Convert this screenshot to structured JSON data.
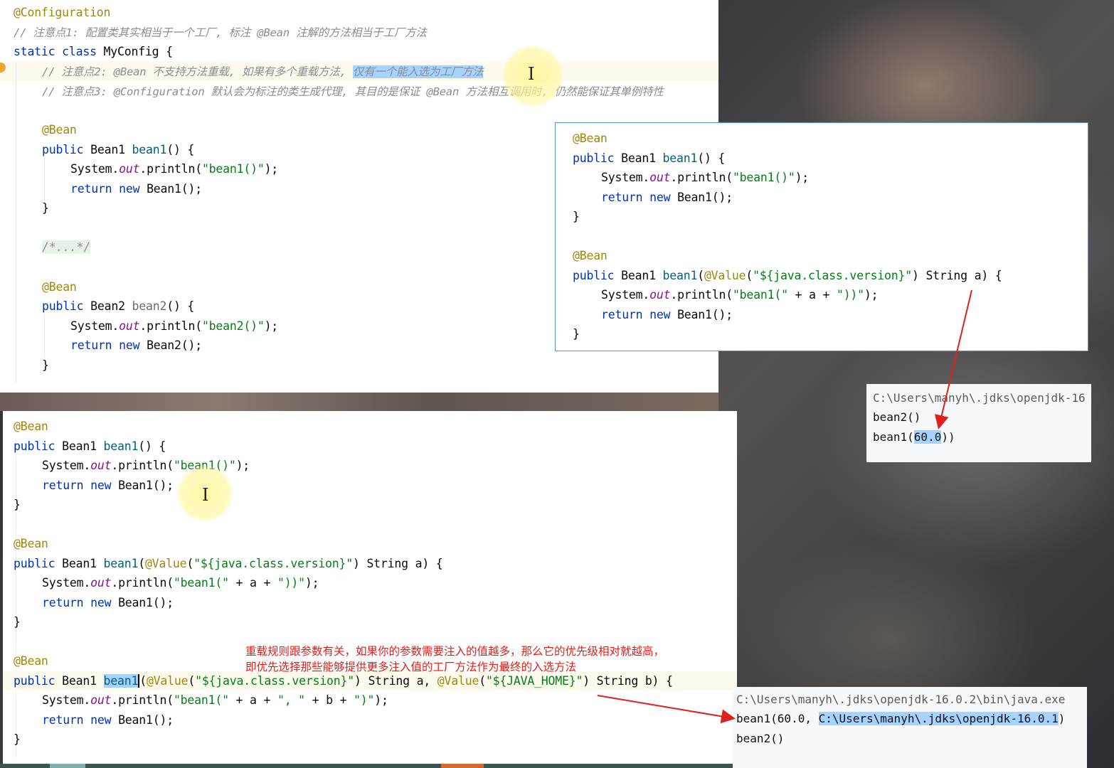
{
  "colors": {
    "keyword": "#0033b3",
    "annotation": "#9e880d",
    "string": "#067d17",
    "static_field": "#871094",
    "method": "#00627a",
    "comment": "#8c8c8c",
    "selection": "#a6d2ff",
    "arrow": "#e0201b"
  },
  "top_editor": {
    "lines": {
      "l1": {
        "ann": "@Configuration"
      },
      "l2": {
        "cmt": "// 注意点1: 配置类其实相当于一个工厂, 标注 @Bean 注解的方法相当于工厂方法"
      },
      "l3": {
        "kw1": "static",
        "kw2": "class",
        "rest": " MyConfig {"
      },
      "l4": {
        "cmt_a": "// 注意点2: @Bean 不支持方法重载, 如果有多个重载方法, ",
        "cmt_sel": "仅有一个能入选为工厂方法"
      },
      "l5": {
        "cmt": "// 注意点3: @Configuration 默认会为标注的类生成代理, 其目的是保证 @Bean 方法相互调用时, 仍然能保证其单例特性"
      },
      "l6": {
        "ann": "@Bean"
      },
      "l7": {
        "kw": "public",
        "type": " Bean1 ",
        "fn": "bean1",
        "rest": "() {"
      },
      "l8": {
        "a": "System.",
        "field": "out",
        "b": ".println(",
        "str": "\"bean1()\"",
        "c": ");"
      },
      "l9": {
        "kw1": "return",
        "kw2": "new",
        "rest": " Bean1();"
      },
      "l10": {
        "brace": "}"
      },
      "l11": {
        "folded": "/*...*/"
      },
      "l12": {
        "ann": "@Bean"
      },
      "l13": {
        "kw": "public",
        "type": " Bean2 ",
        "fn": "bean2",
        "rest": "() {"
      },
      "l14": {
        "a": "System.",
        "field": "out",
        "b": ".println(",
        "str": "\"bean2()\"",
        "c": ");"
      },
      "l15": {
        "kw1": "return",
        "kw2": "new",
        "rest": " Bean2();"
      },
      "l16": {
        "brace": "}"
      }
    }
  },
  "right_editor": {
    "ann1": "@Bean",
    "m1_kw": "public",
    "m1_type": " Bean1 ",
    "m1_fn": "bean1",
    "m1_rest": "() {",
    "m1_a": "System.",
    "m1_field": "out",
    "m1_b": ".println(",
    "m1_str": "\"bean1()\"",
    "m1_c": ");",
    "m1_ret": "return",
    "m1_new": "new",
    "m1_retrest": " Bean1();",
    "brace": "}",
    "ann2": "@Bean",
    "m2_kw": "public",
    "m2_type": " Bean1 ",
    "m2_fn": "bean1",
    "m2_p1": "(",
    "m2_ann": "@Value",
    "m2_p2": "(",
    "m2_str": "\"${java.class.version}\"",
    "m2_rest": ") String a) {",
    "m2_a": "System.",
    "m2_field": "out",
    "m2_b": ".println(",
    "m2_s1": "\"bean1(\"",
    "m2_mid": " + a + ",
    "m2_s2": "\"))\"",
    "m2_c": ");",
    "m2_ret": "return",
    "m2_new": "new",
    "m2_retrest": " Bean1();"
  },
  "console1": {
    "path": "C:\\Users\\manyh\\.jdks\\openjdk-16",
    "line2": "bean2()",
    "line3_a": "bean1(",
    "line3_sel": "60.0",
    "line3_b": "))"
  },
  "bottom_editor": {
    "ann1": "@Bean",
    "m1_kw": "public",
    "m1_type": " Bean1 ",
    "m1_fn": "bean1",
    "m1_rest": "() {",
    "m1_a": "System.",
    "m1_field": "out",
    "m1_b": ".println(",
    "m1_str": "\"bean1()\"",
    "m1_c": ");",
    "m1_ret": "return",
    "m1_new": "new",
    "m1_retrest": " Bean1();",
    "brace": "}",
    "ann2": "@Bean",
    "m2_kw": "public",
    "m2_type": " Bean1 ",
    "m2_fn": "bean1",
    "m2_p1": "(",
    "m2_ann": "@Value",
    "m2_p2": "(",
    "m2_str": "\"${java.class.version}\"",
    "m2_rest": ") String a) {",
    "m2_a": "System.",
    "m2_field": "out",
    "m2_b": ".println(",
    "m2_s1": "\"bean1(\"",
    "m2_mid": " + a + ",
    "m2_s2": "\"))\"",
    "m2_c": ");",
    "m2_ret": "return",
    "m2_new": "new",
    "m2_retrest": " Bean1();",
    "ann3": "@Bean",
    "m3_kw": "public",
    "m3_type": " Bean1 ",
    "m3_fn": "bean1",
    "m3_p1": "(",
    "m3_ann1": "@Value",
    "m3_p2": "(",
    "m3_str1": "\"${java.class.version}\"",
    "m3_mid1": ") String a, ",
    "m3_ann2": "@Value",
    "m3_p3": "(",
    "m3_str2": "\"${JAVA_HOME}\"",
    "m3_rest": ") String b) {",
    "m3_a": "System.",
    "m3_field": "out",
    "m3_b": ".println(",
    "m3_s1": "\"bean1(\"",
    "m3_mid": " + a + ",
    "m3_s2": "\", \"",
    "m3_mid2": " + b + ",
    "m3_s3": "\")\"",
    "m3_c": ");",
    "m3_ret": "return",
    "m3_new": "new",
    "m3_retrest": " Bean1();"
  },
  "note": {
    "line1": "重载规则跟参数有关，如果你的参数需要注入的值越多，那么它的优先级相对就越高，",
    "line2": "即优先选择那些能够提供更多注入值的工厂方法作为最终的入选方法"
  },
  "console2": {
    "path": "C:\\Users\\manyh\\.jdks\\openjdk-16.0.2\\bin\\java.exe",
    "line2_a": "bean1(60.0, ",
    "line2_sel": "C:\\Users\\manyh\\.jdks\\openjdk-16.0.1",
    "line2_b": ")",
    "line3": "bean2()"
  }
}
